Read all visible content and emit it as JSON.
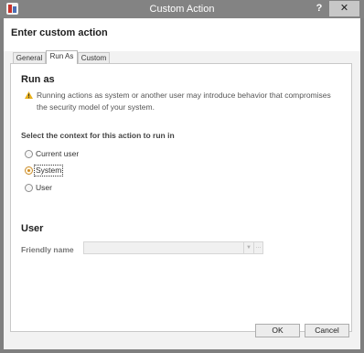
{
  "window": {
    "title": "Custom Action",
    "help_label": "?",
    "close_label": "✕"
  },
  "header": {
    "title": "Enter custom action"
  },
  "tabs": [
    {
      "label": "General",
      "active": false
    },
    {
      "label": "Run As",
      "active": true
    },
    {
      "label": "Custom",
      "active": false
    }
  ],
  "run_as": {
    "heading": "Run as",
    "warning_icon": "warning-triangle-icon",
    "warning_text": "Running actions as system or another user may introduce behavior that compromises the security model of your system.",
    "context_label": "Select the context for this action to run in",
    "options": [
      {
        "label": "Current user",
        "selected": false
      },
      {
        "label": "System",
        "selected": true
      },
      {
        "label": "User",
        "selected": false
      }
    ]
  },
  "user": {
    "heading": "User",
    "friendly_name_label": "Friendly name",
    "friendly_name_value": "",
    "dropdown_icon": "chevron-down-icon",
    "ellipsis_label": "..."
  },
  "footer": {
    "ok_label": "OK",
    "cancel_label": "Cancel"
  },
  "colors": {
    "titlebar": "#838383",
    "warning": "#e8b01c",
    "radio_checked": "#d08a1e"
  }
}
